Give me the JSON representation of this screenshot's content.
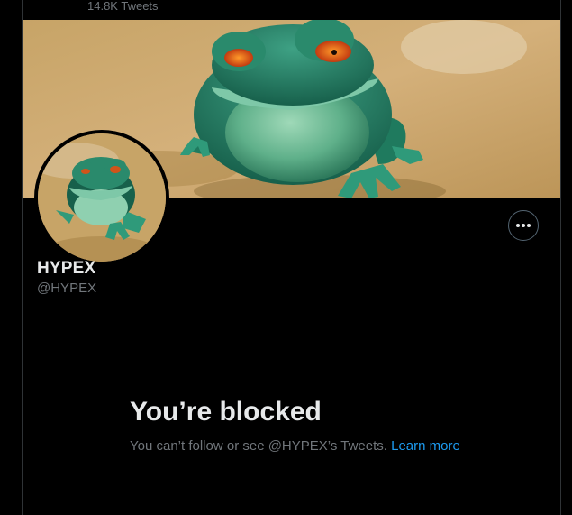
{
  "header": {
    "tweet_count": "14.8K Tweets"
  },
  "profile": {
    "display_name": "HYPEX",
    "handle": "@HYPEX",
    "banner_image": "frog-character-banner",
    "avatar_image": "frog-character-avatar",
    "more_icon": "more-horizontal-icon"
  },
  "blocked": {
    "title": "You’re blocked",
    "description": "You can’t follow or see @HYPEX’s Tweets.",
    "link_label": "Learn more"
  },
  "colors": {
    "background": "#000000",
    "primary_text": "#e7e9ea",
    "secondary_text": "#71767b",
    "link": "#1d9bf0",
    "border": "#2f3336"
  }
}
